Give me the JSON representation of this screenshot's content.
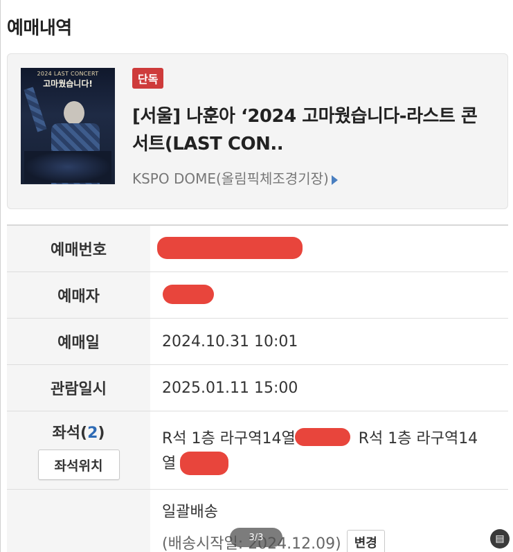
{
  "page_title": "예매내역",
  "event": {
    "badge": "단독",
    "name": "[서울] 나훈아 ‘2024 고마웠습니다-라스트 콘서트(LAST CON..",
    "venue": "KSPO DOME(올림픽체조경기장)",
    "poster_title": "2024 LAST CONCERT",
    "poster_subtitle": "고마웠습니다!"
  },
  "table": {
    "booking_number_label": "예매번호",
    "booker_label": "예매자",
    "booking_date_label": "예매일",
    "booking_date_value": "2024.10.31 10:01",
    "view_datetime_label": "관람일시",
    "view_datetime_value": "2025.01.11 15:00",
    "seats_label": "좌석",
    "seats_count": "2",
    "seat_location_button": "좌석위치",
    "seat_1": "R석 1층 라구역14열",
    "seat_2_prefix": "R석 1층 라구역14",
    "seat_2_suffix": "열",
    "delivery_method": "일괄배송",
    "delivery_start": "(배송시작일: 2024.12.09)",
    "change_button": "변경"
  },
  "viewer": {
    "pager": "3/3"
  },
  "colors": {
    "badge": "#ce3b3b",
    "redaction": "#e8453c",
    "seat_count": "#2e6bb5",
    "venue_arrow": "#4a7fc0"
  }
}
